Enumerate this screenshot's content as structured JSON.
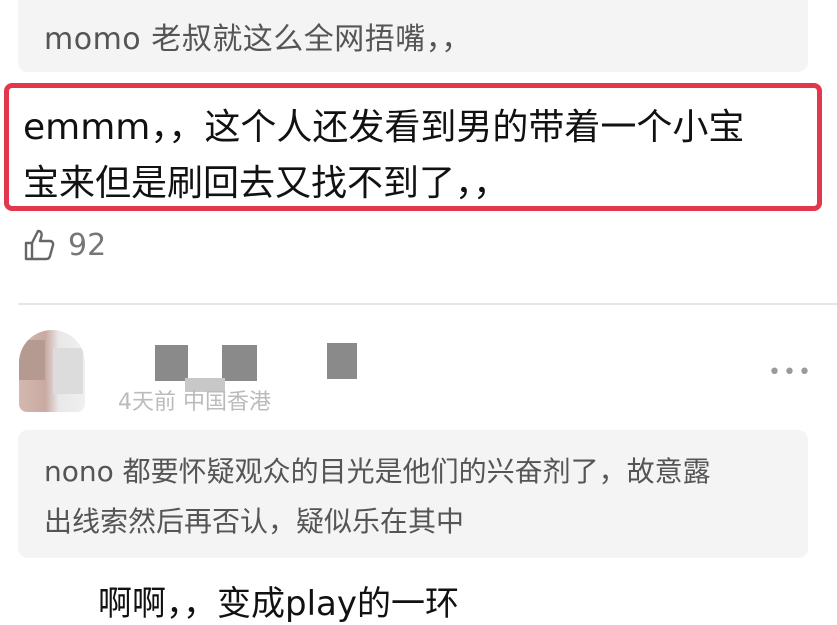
{
  "top_quote": {
    "text": "momo 老叔就这么全网捂嘴，，"
  },
  "highlighted_comment": {
    "line1": "emmm，，这个人还发看到男的带着一个小宝",
    "line2": "宝来但是刷回去又找不到了，，"
  },
  "like": {
    "icon": "thumbs-up-icon",
    "count": "92"
  },
  "comment2": {
    "meta": "4天前 中国香港",
    "more_icon": "more-dots-icon",
    "more_label": "•••",
    "quote_line1": "nono 都要怀疑观众的目光是他们的兴奋剂了，故意露",
    "quote_line2": "出线索然后再否认，疑似乐在其中",
    "reply": "啊啊，，变成play的一环"
  },
  "colors": {
    "highlight_border": "#e2384e",
    "quote_bg": "#f4f4f4"
  }
}
